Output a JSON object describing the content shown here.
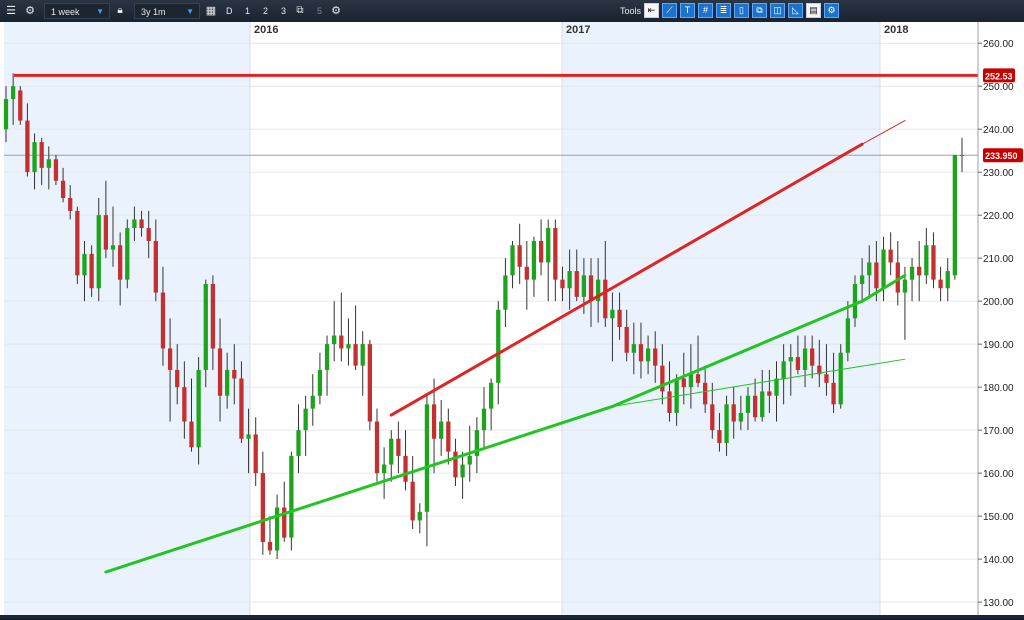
{
  "toolbar": {
    "interval": "1 week",
    "range": "3y 1m",
    "period_buttons": [
      "D",
      "1",
      "2",
      "3",
      "5"
    ],
    "tools_label": "Tools"
  },
  "icons": [
    "menu-icon",
    "gear-icon",
    "lock-icon",
    "calendar-icon",
    "compare-icon",
    "settings-icon",
    "arrow-left-icon",
    "line-tool-icon",
    "text-tool-icon",
    "grid-tool-icon",
    "fibonacci-tool-icon",
    "candle-tool-icon",
    "layers-icon",
    "tag-icon",
    "shape-icon",
    "print-icon",
    "tool-settings-icon"
  ],
  "colors": {
    "up": "#1ca51c",
    "down": "#c42f2f",
    "shade": "#eaf3fd",
    "support_line": "#22c422",
    "resistance_line": "#e02424",
    "price_tag": "#c80000"
  },
  "chart_data": {
    "type": "candlestick",
    "x_axis": {
      "labels": [
        "2016",
        "2017",
        "2018"
      ]
    },
    "y_axis": {
      "position": "right",
      "range": [
        127,
        264
      ],
      "ticks": [
        130,
        140,
        150,
        160,
        170,
        180,
        190,
        200,
        210,
        220,
        230,
        240,
        250,
        260
      ],
      "tick_labels": [
        "130.00",
        "140.00",
        "150.00",
        "160.00",
        "170.00",
        "180.00",
        "190.00",
        "200.00",
        "210.00",
        "220.00",
        "230.00",
        "240.00",
        "250.00",
        "260.00"
      ]
    },
    "price_labels": [
      {
        "value": 252.53,
        "text": "252.53"
      },
      {
        "value": 233.95,
        "text": "233.950"
      }
    ],
    "horizontal_lines": [
      {
        "value": 252.53,
        "color": "red"
      },
      {
        "value": 233.95,
        "color": "gray"
      }
    ],
    "trend_lines": [
      {
        "color": "green",
        "points": [
          [
            14,
            137
          ],
          [
            85,
            175.5
          ]
        ]
      },
      {
        "color": "green",
        "points": [
          [
            85,
            175.5
          ],
          [
            126,
            186.5
          ]
        ],
        "thin": true
      },
      {
        "color": "green",
        "points": [
          [
            85,
            175.5
          ],
          [
            120,
            200
          ],
          [
            126,
            206
          ]
        ]
      },
      {
        "color": "red",
        "points": [
          [
            54,
            173.5
          ],
          [
            120,
            236.5
          ],
          [
            126,
            242
          ]
        ],
        "thin_after": 120
      }
    ],
    "candles": [
      [
        240,
        250,
        237,
        247
      ],
      [
        247,
        253,
        241,
        250
      ],
      [
        249,
        250,
        241,
        242
      ],
      [
        242,
        246,
        229,
        230
      ],
      [
        230,
        239,
        226,
        237
      ],
      [
        237,
        238,
        227,
        231
      ],
      [
        231,
        236,
        226,
        233
      ],
      [
        233,
        234,
        227,
        228
      ],
      [
        228,
        231,
        223,
        224
      ],
      [
        224,
        227,
        219,
        221
      ],
      [
        221,
        222,
        204,
        206
      ],
      [
        206,
        214,
        200,
        211
      ],
      [
        211,
        213,
        201,
        203
      ],
      [
        203,
        224,
        200,
        220
      ],
      [
        220,
        228,
        210,
        212
      ],
      [
        212,
        222,
        208,
        213
      ],
      [
        213,
        216,
        199,
        205
      ],
      [
        205,
        219,
        203,
        217
      ],
      [
        217,
        222,
        214,
        219
      ],
      [
        219,
        221,
        215,
        217
      ],
      [
        217,
        221,
        210,
        214
      ],
      [
        214,
        219,
        200,
        202
      ],
      [
        202,
        208,
        185,
        189
      ],
      [
        189,
        196,
        172,
        184
      ],
      [
        184,
        190,
        176,
        180
      ],
      [
        180,
        186,
        168,
        172
      ],
      [
        172,
        182,
        165,
        166
      ],
      [
        166,
        187,
        162,
        184
      ],
      [
        184,
        205,
        180,
        204
      ],
      [
        204,
        206,
        184,
        189
      ],
      [
        189,
        196,
        172,
        178
      ],
      [
        178,
        188,
        175,
        184
      ],
      [
        184,
        190,
        176,
        182
      ],
      [
        182,
        186,
        167,
        168
      ],
      [
        168,
        175,
        160,
        169
      ],
      [
        169,
        173,
        157,
        160
      ],
      [
        160,
        165,
        141,
        144
      ],
      [
        144,
        150,
        141,
        142
      ],
      [
        142,
        155,
        140,
        152
      ],
      [
        152,
        158,
        144,
        145
      ],
      [
        145,
        165,
        142,
        164
      ],
      [
        164,
        176,
        160,
        170
      ],
      [
        170,
        178,
        164,
        175
      ],
      [
        175,
        183,
        171,
        178
      ],
      [
        178,
        188,
        176,
        184
      ],
      [
        184,
        192,
        178,
        190
      ],
      [
        190,
        200,
        186,
        192
      ],
      [
        192,
        202,
        186,
        189
      ],
      [
        189,
        196,
        185,
        190
      ],
      [
        190,
        199,
        184,
        185
      ],
      [
        185,
        193,
        178,
        190
      ],
      [
        190,
        191,
        170,
        172
      ],
      [
        172,
        175,
        158,
        160
      ],
      [
        160,
        166,
        154,
        162
      ],
      [
        162,
        170,
        158,
        168
      ],
      [
        168,
        172,
        160,
        164
      ],
      [
        164,
        170,
        156,
        158
      ],
      [
        158,
        164,
        147,
        149
      ],
      [
        149,
        153,
        146,
        151
      ],
      [
        151,
        178,
        143,
        176
      ],
      [
        176,
        182,
        160,
        168
      ],
      [
        168,
        177,
        164,
        172
      ],
      [
        172,
        175,
        162,
        165
      ],
      [
        165,
        168,
        157,
        159
      ],
      [
        159,
        165,
        154,
        162
      ],
      [
        162,
        171,
        158,
        164
      ],
      [
        164,
        173,
        160,
        170
      ],
      [
        170,
        180,
        166,
        175
      ],
      [
        175,
        182,
        170,
        181
      ],
      [
        181,
        200,
        176,
        198
      ],
      [
        198,
        210,
        194,
        206
      ],
      [
        206,
        214,
        203,
        213
      ],
      [
        213,
        218,
        204,
        208
      ],
      [
        208,
        214,
        198,
        205
      ],
      [
        205,
        215,
        201,
        214
      ],
      [
        214,
        219,
        206,
        209
      ],
      [
        209,
        219,
        200,
        217
      ],
      [
        217,
        219,
        200,
        205
      ],
      [
        205,
        208,
        200,
        203
      ],
      [
        203,
        212,
        198,
        207
      ],
      [
        207,
        212,
        200,
        201
      ],
      [
        201,
        210,
        197,
        206
      ],
      [
        206,
        210,
        194,
        200
      ],
      [
        200,
        210,
        195,
        205
      ],
      [
        205,
        214,
        194,
        196
      ],
      [
        196,
        202,
        186,
        198
      ],
      [
        198,
        202,
        191,
        194
      ],
      [
        194,
        198,
        186,
        188
      ],
      [
        188,
        195,
        183,
        190
      ],
      [
        190,
        195,
        182,
        186
      ],
      [
        186,
        192,
        183,
        189
      ],
      [
        189,
        193,
        181,
        185
      ],
      [
        185,
        190,
        176,
        179
      ],
      [
        179,
        186,
        172,
        174
      ],
      [
        174,
        183,
        171,
        182
      ],
      [
        182,
        188,
        176,
        180
      ],
      [
        180,
        190,
        175,
        183
      ],
      [
        183,
        192,
        180,
        181
      ],
      [
        181,
        185,
        174,
        176
      ],
      [
        176,
        181,
        168,
        170
      ],
      [
        170,
        174,
        165,
        167
      ],
      [
        167,
        178,
        164,
        176
      ],
      [
        176,
        180,
        168,
        172
      ],
      [
        172,
        178,
        170,
        174
      ],
      [
        174,
        180,
        170,
        178
      ],
      [
        178,
        182,
        172,
        173
      ],
      [
        173,
        184,
        172,
        179
      ],
      [
        179,
        184,
        174,
        178
      ],
      [
        178,
        186,
        172,
        182
      ],
      [
        182,
        190,
        176,
        186
      ],
      [
        186,
        190,
        178,
        187
      ],
      [
        187,
        192,
        183,
        184
      ],
      [
        184,
        192,
        180,
        189
      ],
      [
        189,
        192,
        182,
        185
      ],
      [
        185,
        191,
        180,
        183
      ],
      [
        183,
        190,
        178,
        181
      ],
      [
        181,
        188,
        174,
        176
      ],
      [
        176,
        190,
        175,
        188
      ],
      [
        188,
        200,
        186,
        196
      ],
      [
        196,
        206,
        194,
        204
      ],
      [
        204,
        210,
        200,
        206
      ],
      [
        206,
        213,
        201,
        209
      ],
      [
        209,
        214,
        200,
        203
      ],
      [
        203,
        215,
        200,
        212
      ],
      [
        212,
        216,
        206,
        209
      ],
      [
        209,
        214,
        199,
        202
      ],
      [
        202,
        208,
        191,
        205
      ],
      [
        205,
        210,
        200,
        208
      ],
      [
        208,
        214,
        200,
        206
      ],
      [
        206,
        217,
        204,
        213
      ],
      [
        213,
        216,
        203,
        205
      ],
      [
        205,
        208,
        200,
        203
      ],
      [
        203,
        210,
        200,
        207
      ],
      [
        206,
        233,
        205,
        234
      ],
      [
        234,
        238,
        230,
        234
      ]
    ]
  }
}
